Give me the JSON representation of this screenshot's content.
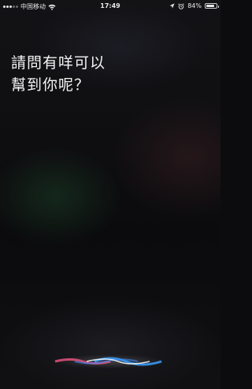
{
  "status_bar": {
    "carrier": "中国移动",
    "time": "17:49",
    "battery_percent": "84%",
    "battery_level": 0.84,
    "icons": [
      "signal-icon",
      "wifi-icon",
      "location-icon",
      "alarm-icon",
      "battery-icon"
    ]
  },
  "siri": {
    "prompt_line1": "請問有咩可以",
    "prompt_line2": "幫到你呢？"
  },
  "colors": {
    "wave_blue": "#3aa0ff",
    "wave_pink": "#ff5a8a",
    "wave_white": "#ffffff"
  }
}
